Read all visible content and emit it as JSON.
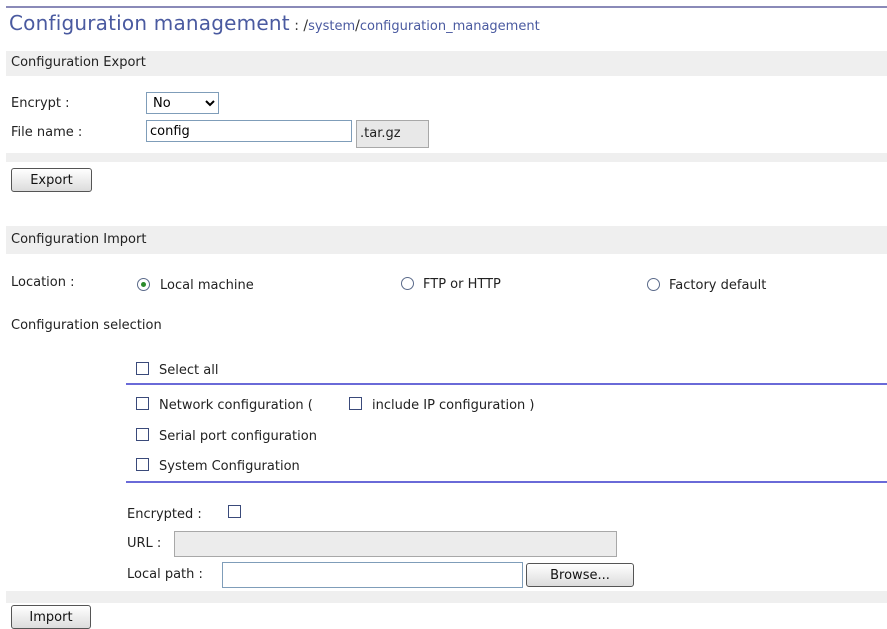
{
  "header": {
    "title": "Configuration management",
    "separator": " : ",
    "path_root": "/",
    "path_system": "system",
    "path_slash": "/",
    "path_page": "configuration_management"
  },
  "export": {
    "section_title": "Configuration Export",
    "encrypt_label": "Encrypt :",
    "encrypt_selected": "No",
    "filename_label": "File name :",
    "filename_value": "config",
    "filename_suffix": ".tar.gz",
    "export_button": "Export"
  },
  "import": {
    "section_title": "Configuration Import",
    "location_label": "Location :",
    "location_options": [
      "Local machine",
      "FTP or HTTP",
      "Factory default"
    ],
    "location_selected": "Local machine",
    "selection_title": "Configuration selection",
    "select_all": "Select all",
    "network_config": "Network configuration (",
    "include_ip": "include IP configuration )",
    "serial_config": "Serial port configuration",
    "system_config": "System Configuration",
    "encrypted_label": "Encrypted :",
    "url_label": "URL :",
    "url_value": "",
    "local_path_label": "Local path :",
    "local_path_value": "",
    "browse_button": "Browse...",
    "import_button": "Import"
  },
  "colors": {
    "title_blue": "#4a5aa0",
    "band_gray": "#efefef",
    "divider_blue": "#6a6ad8"
  }
}
